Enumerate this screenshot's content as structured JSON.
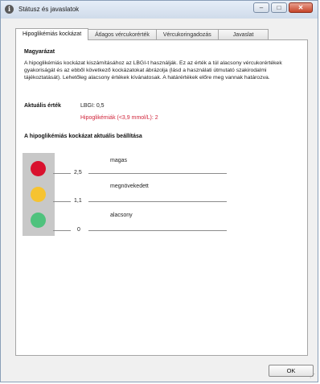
{
  "window": {
    "title": "Státusz és javaslatok",
    "minimize": "–",
    "maximize": "□",
    "close": "✕"
  },
  "tabs": [
    {
      "label": "Hipoglikémiás kockázat",
      "active": true
    },
    {
      "label": "Átlagos vércukorérték",
      "active": false
    },
    {
      "label": "Vércukoringadozás",
      "active": false
    },
    {
      "label": "Javaslat",
      "active": false
    }
  ],
  "explanation": {
    "heading": "Magyarázat",
    "text": "A hipoglikémiás kockázat kiszámításához az LBGI-t használják. Ez az érték a túl alacsony vércukorértékek gyakoriságát és az ebből következő kockázatokat ábrázolja (lásd a használati útmutató szakirodalmi tájékoztatását). Lehetőleg alacsony értékek kívánatosak. A határértékek előre meg vannak határozva."
  },
  "current": {
    "label": "Aktuális érték",
    "lbgi": "LBGI: 0,5",
    "hypos": "Hipoglikémiák (<3,9 mmol/L): 2"
  },
  "settings": {
    "heading": "A hipoglikémiás kockázat aktuális beállítása",
    "levels": [
      {
        "label": "magas",
        "color": "#d9112e"
      },
      {
        "label": "megnövekedett",
        "color": "#f6c331"
      },
      {
        "label": "alacsony",
        "color": "#4fc27d"
      }
    ],
    "thresholds": [
      "2,5",
      "1,1",
      "0"
    ]
  },
  "footer": {
    "ok_label": "OK",
    "grip": "⋰"
  }
}
